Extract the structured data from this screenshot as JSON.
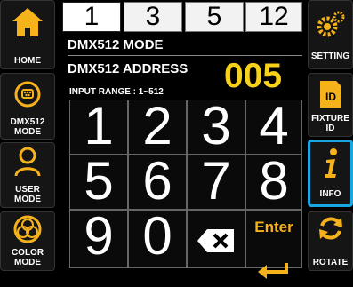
{
  "sidebar_left": [
    {
      "label": "HOME",
      "icon": "home-icon",
      "color": "#f6b21b"
    },
    {
      "label": "DMX512\nMODE",
      "icon": "dmx-connector-icon",
      "color": "#f6b21b"
    },
    {
      "label": "USER\nMODE",
      "icon": "user-icon",
      "color": "#f6b21b"
    },
    {
      "label": "COLOR\nMODE",
      "icon": "color-wheel-icon",
      "color": "#f6b21b"
    }
  ],
  "sidebar_right": [
    {
      "label": "SETTING",
      "icon": "gears-icon",
      "color": "#f6b21b"
    },
    {
      "label": "FIXTURE\nID",
      "icon": "id-card-icon",
      "color": "#f6b21b"
    },
    {
      "label": "INFO",
      "icon": "info-icon",
      "color": "#f6b21b"
    },
    {
      "label": "ROTATE",
      "icon": "rotate-icon",
      "color": "#f6b21b"
    }
  ],
  "tabs": [
    "1",
    "3",
    "5",
    "12"
  ],
  "header": {
    "mode_title": "DMX512 MODE",
    "address_label": "DMX512 ADDRESS",
    "address_value": "005",
    "input_range": "INPUT RANGE : 1~512"
  },
  "keypad": {
    "keys": [
      "1",
      "2",
      "3",
      "4",
      "5",
      "6",
      "7",
      "8",
      "9",
      "0"
    ],
    "enter_label": "Enter",
    "backspace_icon": "backspace-icon"
  },
  "colors": {
    "accent": "#f6b21b",
    "address": "#f6d21b",
    "highlight": "#1aa6e0"
  }
}
